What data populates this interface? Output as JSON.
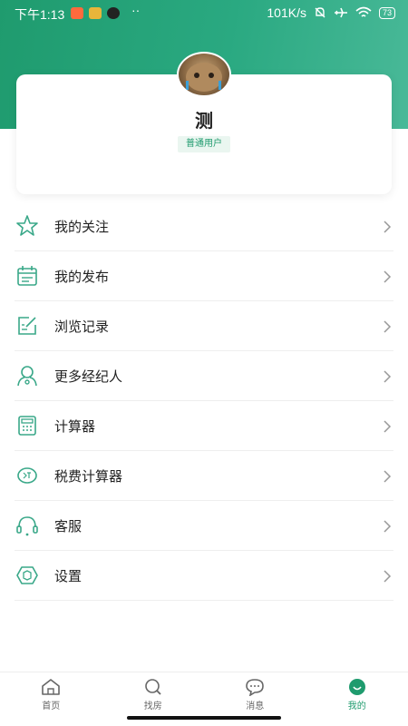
{
  "status_bar": {
    "time": "下午1:13",
    "network_speed": "101K/s",
    "battery": "73"
  },
  "profile": {
    "name": "测",
    "badge": "普通用户"
  },
  "menu": [
    {
      "label": "我的关注",
      "icon": "star-icon"
    },
    {
      "label": "我的发布",
      "icon": "calendar-icon"
    },
    {
      "label": "浏览记录",
      "icon": "edit-note-icon"
    },
    {
      "label": "更多经纪人",
      "icon": "agent-icon"
    },
    {
      "label": "计算器",
      "icon": "calculator-icon"
    },
    {
      "label": "税费计算器",
      "icon": "tax-icon"
    },
    {
      "label": "客服",
      "icon": "headset-icon"
    },
    {
      "label": "设置",
      "icon": "settings-hexagon-icon"
    }
  ],
  "tabs": [
    {
      "label": "首页",
      "icon": "home-icon"
    },
    {
      "label": "找房",
      "icon": "search-icon"
    },
    {
      "label": "消息",
      "icon": "message-icon"
    },
    {
      "label": "我的",
      "icon": "profile-smile-icon",
      "active": true
    }
  ],
  "colors": {
    "accent": "#1f9b6e",
    "header_gradient_end": "#49b998"
  }
}
